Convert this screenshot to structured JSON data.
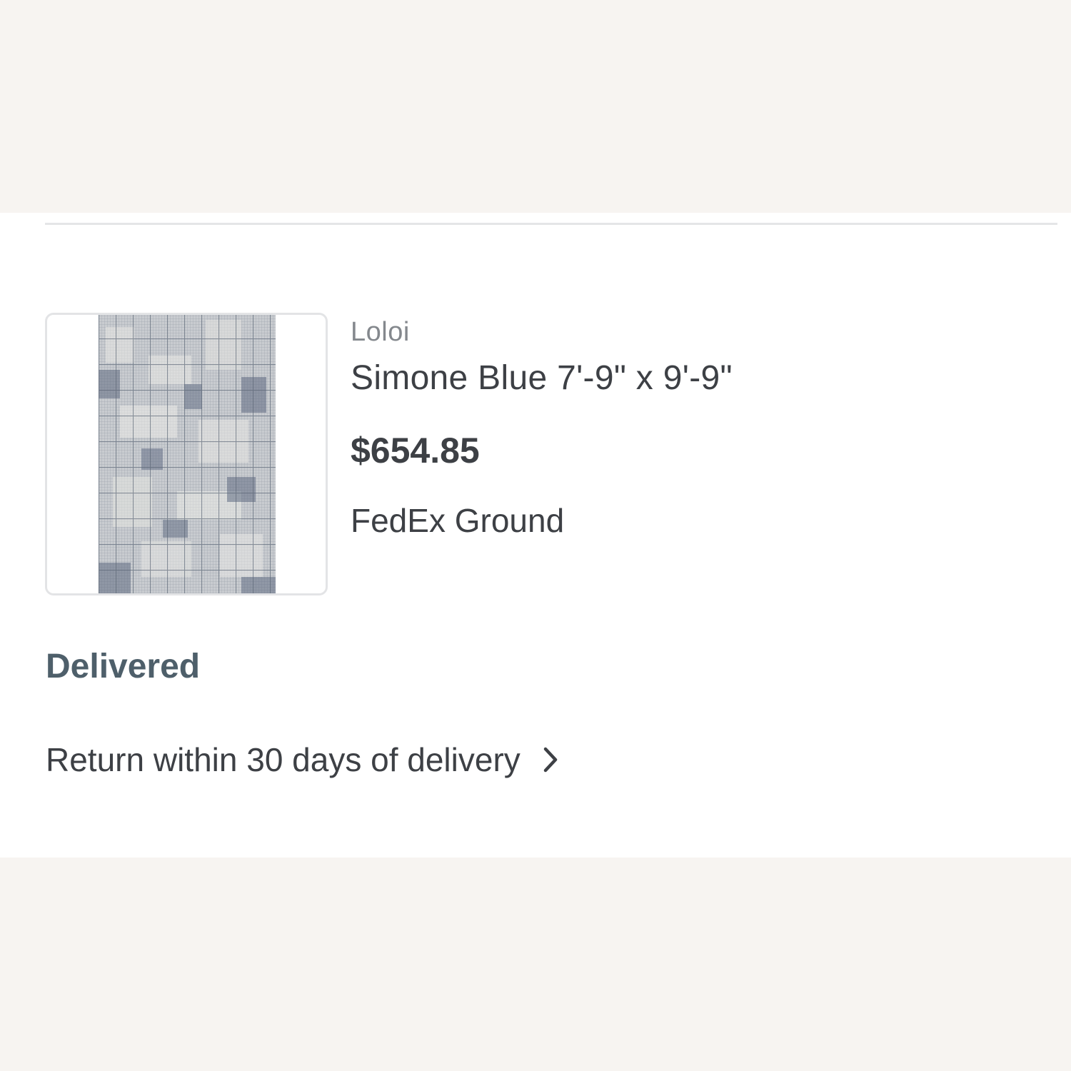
{
  "order_item": {
    "brand": "Loloi",
    "product_name": "Simone Blue 7'-9\" x 9'-9\"",
    "price": "$654.85",
    "shipping_method": "FedEx Ground",
    "status": "Delivered",
    "return_link_label": "Return within 30 days of delivery"
  },
  "icons": {
    "return_chevron": "chevron-right-icon",
    "product_image": "rug-image"
  },
  "colors": {
    "page_background": "#f7f4f1",
    "card_background": "#ffffff",
    "status_text": "#4e5f6a",
    "primary_text": "#3d4045",
    "secondary_text": "#84888d"
  }
}
